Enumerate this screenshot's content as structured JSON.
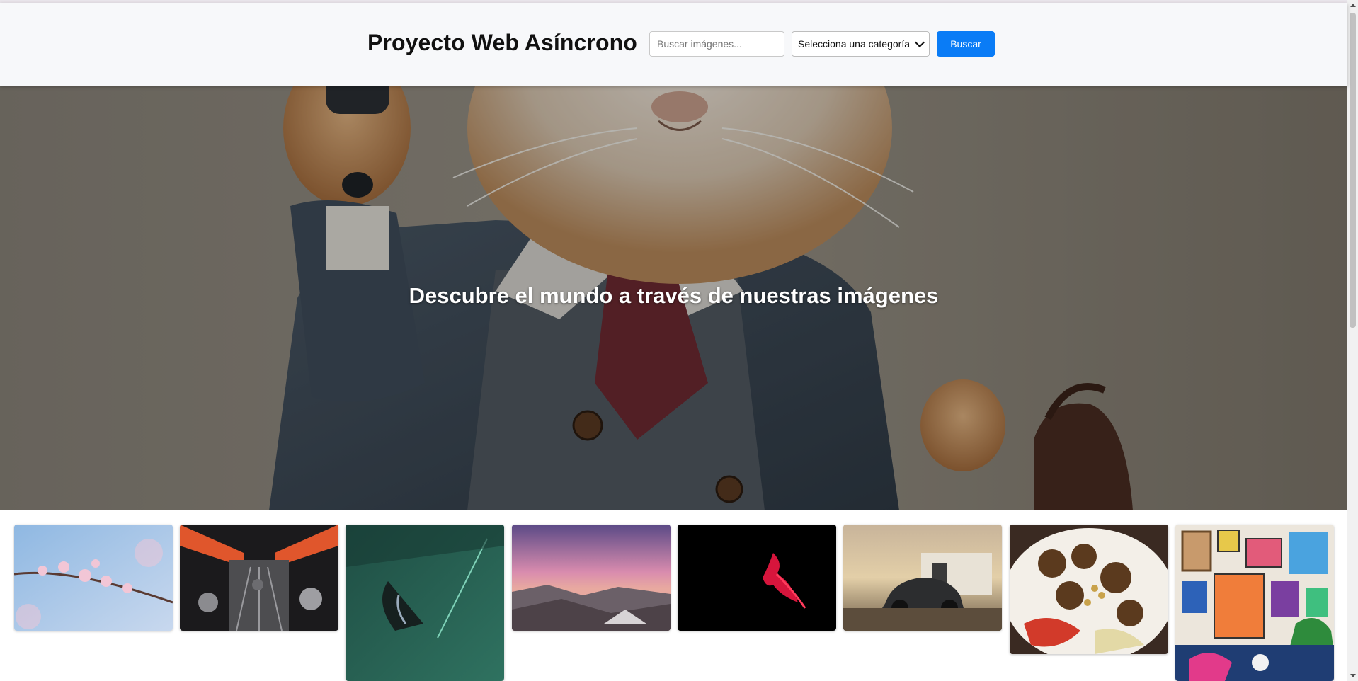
{
  "header": {
    "title": "Proyecto Web Asíncrono",
    "search_placeholder": "Buscar imágenes...",
    "category_selected": "Selecciona una categoría",
    "search_button": "Buscar"
  },
  "hero": {
    "title": "Descubre el mundo a través de nuestras imágenes",
    "image_icon": "cat-in-coat-image"
  },
  "gallery": {
    "items": [
      {
        "icon": "cherry-blossom-image"
      },
      {
        "icon": "escalator-image"
      },
      {
        "icon": "green-car-image"
      },
      {
        "icon": "pink-sunset-image"
      },
      {
        "icon": "red-fish-image"
      },
      {
        "icon": "black-car-image"
      },
      {
        "icon": "falafel-plate-image"
      },
      {
        "icon": "art-wall-image"
      }
    ]
  },
  "colors": {
    "accent": "#0a7cf6",
    "header_bg": "#f7f8fa"
  }
}
